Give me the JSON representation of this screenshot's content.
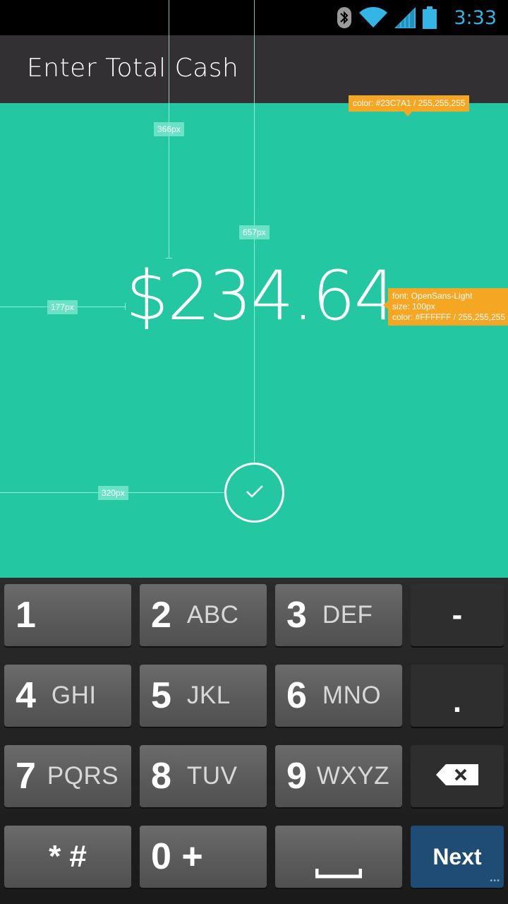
{
  "status_bar": {
    "time": "3:33",
    "icons": [
      "bluetooth-icon",
      "wifi-icon",
      "signal-icon",
      "battery-icon"
    ],
    "time_color": "#33B5E5"
  },
  "action_bar": {
    "title": "Enter Total Cash",
    "background": "#323033"
  },
  "main": {
    "background": "#23C7A1",
    "amount": "$234.64",
    "confirm_icon": "checkmark-icon"
  },
  "annotations": {
    "measurements": [
      "366px",
      "657px",
      "177px",
      "320px"
    ],
    "background_note": "color: #23C7A1 / 255,255,255",
    "amount_note": {
      "font": "font: OpenSans-Light",
      "size": "size: 100px",
      "color": "color: #FFFFFF / 255,255,255"
    }
  },
  "keyboard": {
    "rows": [
      [
        {
          "digit": "1",
          "letters": ""
        },
        {
          "digit": "2",
          "letters": "ABC"
        },
        {
          "digit": "3",
          "letters": "DEF"
        },
        {
          "symbol": "-"
        }
      ],
      [
        {
          "digit": "4",
          "letters": "GHI"
        },
        {
          "digit": "5",
          "letters": "JKL"
        },
        {
          "digit": "6",
          "letters": "MNO"
        },
        {
          "symbol": "."
        }
      ],
      [
        {
          "digit": "7",
          "letters": "PQRS"
        },
        {
          "digit": "8",
          "letters": "TUV"
        },
        {
          "digit": "9",
          "letters": "WXYZ"
        },
        {
          "icon": "backspace-icon"
        }
      ],
      [
        {
          "symbol": "* #"
        },
        {
          "digit": "0 +",
          "letters": ""
        },
        {
          "icon": "space-bar-icon"
        },
        {
          "label": "Next"
        }
      ]
    ],
    "next_color": "#1E4C74"
  }
}
